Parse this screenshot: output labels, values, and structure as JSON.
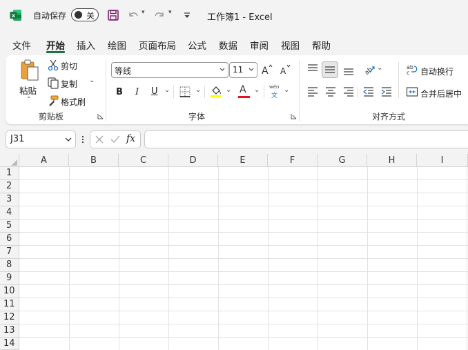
{
  "title_bar": {
    "autosave_label": "自动保存",
    "autosave_state": "关",
    "document_title": "工作簿1  -  Excel",
    "brand_color": "#107c41"
  },
  "menu": {
    "items": [
      "文件",
      "开始",
      "插入",
      "绘图",
      "页面布局",
      "公式",
      "数据",
      "审阅",
      "视图",
      "帮助"
    ],
    "active": "开始"
  },
  "ribbon": {
    "clipboard": {
      "paste": "粘贴",
      "cut": "剪切",
      "copy": "复制",
      "format_painter": "格式刷",
      "group_label": "剪贴板"
    },
    "font": {
      "font_name": "等线",
      "font_size": "11",
      "bold": "B",
      "italic": "I",
      "underline": "U",
      "font_color_glyph": "A",
      "phonetic_top": "wén",
      "phonetic_bottom": "文",
      "group_label": "字体",
      "highlight_color": "#ffff00",
      "font_color": "#e81123"
    },
    "alignment": {
      "wrap_text": "自动换行",
      "merge_center": "合并后居中",
      "group_label": "对齐方式"
    }
  },
  "formula_bar": {
    "name_box": "J31",
    "fx": "fx",
    "formula": ""
  },
  "grid": {
    "columns": [
      "A",
      "B",
      "C",
      "D",
      "E",
      "F",
      "G",
      "H",
      "I"
    ],
    "rows": [
      "1",
      "2",
      "3",
      "4",
      "5",
      "6",
      "7",
      "8",
      "9",
      "10",
      "11",
      "12",
      "13",
      "14"
    ]
  }
}
